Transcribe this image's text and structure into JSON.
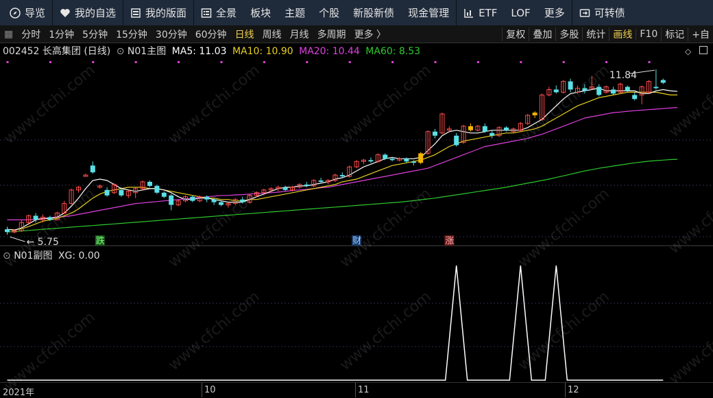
{
  "nav": {
    "items": [
      {
        "label": "导览",
        "icon": "compass-icon"
      },
      {
        "label": "我的自选",
        "icon": "heart-icon"
      },
      {
        "label": "我的版面",
        "icon": "layout-icon"
      },
      {
        "label": "全景",
        "icon": "panorama-icon"
      },
      {
        "label": "板块"
      },
      {
        "label": "主题"
      },
      {
        "label": "个股"
      },
      {
        "label": "新股新债"
      },
      {
        "label": "现金管理"
      },
      {
        "label": "ETF",
        "icon": "chart-icon"
      },
      {
        "label": "LOF"
      },
      {
        "label": "更多"
      },
      {
        "label": "可转债",
        "icon": "bond-icon"
      }
    ]
  },
  "toolbar": {
    "periods": [
      "分时",
      "1分钟",
      "5分钟",
      "15分钟",
      "30分钟",
      "60分钟",
      "日线",
      "周线",
      "月线",
      "多周期",
      "更多 〉"
    ],
    "active_period": "日线",
    "right": [
      "复权",
      "叠加",
      "多股",
      "统计",
      "画线",
      "F10",
      "标记",
      "+自"
    ]
  },
  "main_legend": {
    "stock": "002452 长高集团 (日线)",
    "indicator": "N01主图",
    "ma5": "MA5: 11.03",
    "ma10": "MA10: 10.90",
    "ma20": "MA20: 10.44",
    "ma60": "MA60: 8.53"
  },
  "sub_legend": {
    "indicator": "N01副图",
    "xg": "XG: 0.00"
  },
  "markers": {
    "die": "跌",
    "cai": "财",
    "zhang": "涨"
  },
  "annotations": {
    "high": "11.84",
    "low": "5.75"
  },
  "xaxis": [
    "2021年",
    "10",
    "11",
    "12"
  ],
  "watermark": "www.cfchi.com",
  "colors": {
    "up": "#ff4d4d",
    "down": "#5ae0e6",
    "gold": "#f5b400",
    "ma5": "#ffffff",
    "ma10": "#e8d020",
    "ma20": "#e040e0",
    "ma60": "#2ec82e",
    "xg": "#ffffff",
    "marker": "#e040e0"
  },
  "chart_data": {
    "type": "candlestick",
    "price_range": [
      5.5,
      12.3
    ],
    "candles": [
      {
        "o": 5.95,
        "h": 6.05,
        "l": 5.75,
        "c": 5.85
      },
      {
        "o": 5.85,
        "h": 5.95,
        "l": 5.8,
        "c": 5.9
      },
      {
        "o": 5.9,
        "h": 6.3,
        "l": 5.85,
        "c": 6.2
      },
      {
        "o": 6.2,
        "h": 6.5,
        "l": 6.15,
        "c": 6.45
      },
      {
        "o": 6.45,
        "h": 6.55,
        "l": 6.2,
        "c": 6.3
      },
      {
        "o": 6.3,
        "h": 6.5,
        "l": 6.2,
        "c": 6.4
      },
      {
        "o": 6.4,
        "h": 6.45,
        "l": 6.25,
        "c": 6.3
      },
      {
        "o": 6.3,
        "h": 6.6,
        "l": 6.28,
        "c": 6.55
      },
      {
        "o": 6.55,
        "h": 7.0,
        "l": 6.5,
        "c": 6.9
      },
      {
        "o": 6.9,
        "h": 7.45,
        "l": 6.85,
        "c": 7.4
      },
      {
        "o": 7.4,
        "h": 7.55,
        "l": 7.3,
        "c": 7.5
      },
      {
        "o": 7.9,
        "h": 8.0,
        "l": 7.9,
        "c": 7.95
      },
      {
        "o": 8.3,
        "h": 8.45,
        "l": 8.0,
        "c": 8.05
      },
      {
        "o": 7.5,
        "h": 7.6,
        "l": 7.45,
        "c": 7.55
      },
      {
        "o": 7.4,
        "h": 7.5,
        "l": 7.15,
        "c": 7.2
      },
      {
        "o": 7.3,
        "h": 7.65,
        "l": 7.25,
        "c": 7.6
      },
      {
        "o": 7.4,
        "h": 7.5,
        "l": 7.15,
        "c": 7.2
      },
      {
        "o": 7.2,
        "h": 7.4,
        "l": 7.1,
        "c": 7.35
      },
      {
        "o": 7.3,
        "h": 7.5,
        "l": 7.1,
        "c": 7.45
      },
      {
        "o": 7.45,
        "h": 7.75,
        "l": 7.4,
        "c": 7.7
      },
      {
        "o": 7.7,
        "h": 7.75,
        "l": 7.5,
        "c": 7.55
      },
      {
        "o": 7.55,
        "h": 7.6,
        "l": 7.25,
        "c": 7.3
      },
      {
        "o": 7.3,
        "h": 7.35,
        "l": 7.1,
        "c": 7.15
      },
      {
        "o": 7.2,
        "h": 7.25,
        "l": 6.65,
        "c": 6.85
      },
      {
        "o": 6.85,
        "h": 7.05,
        "l": 6.8,
        "c": 7.0
      },
      {
        "o": 7.0,
        "h": 7.2,
        "l": 6.95,
        "c": 7.15
      },
      {
        "o": 7.15,
        "h": 7.2,
        "l": 6.95,
        "c": 7.0
      },
      {
        "o": 7.0,
        "h": 7.2,
        "l": 6.95,
        "c": 7.15
      },
      {
        "o": 7.15,
        "h": 7.2,
        "l": 6.95,
        "c": 7.05
      },
      {
        "o": 7.05,
        "h": 7.1,
        "l": 6.85,
        "c": 6.95
      },
      {
        "o": 6.95,
        "h": 7.0,
        "l": 6.8,
        "c": 6.85
      },
      {
        "o": 6.85,
        "h": 6.95,
        "l": 6.75,
        "c": 6.9
      },
      {
        "o": 6.9,
        "h": 7.1,
        "l": 6.85,
        "c": 7.05
      },
      {
        "o": 7.05,
        "h": 7.15,
        "l": 6.9,
        "c": 6.95
      },
      {
        "o": 6.95,
        "h": 7.25,
        "l": 6.9,
        "c": 7.2
      },
      {
        "o": 7.2,
        "h": 7.35,
        "l": 7.15,
        "c": 7.3
      },
      {
        "o": 7.3,
        "h": 7.45,
        "l": 7.2,
        "c": 7.4
      },
      {
        "o": 7.4,
        "h": 7.5,
        "l": 7.3,
        "c": 7.45
      },
      {
        "o": 7.45,
        "h": 7.55,
        "l": 7.35,
        "c": 7.5
      },
      {
        "o": 7.5,
        "h": 7.55,
        "l": 7.35,
        "c": 7.4
      },
      {
        "o": 7.4,
        "h": 7.55,
        "l": 7.35,
        "c": 7.5
      },
      {
        "o": 7.5,
        "h": 7.65,
        "l": 7.45,
        "c": 7.6
      },
      {
        "o": 7.6,
        "h": 7.7,
        "l": 7.5,
        "c": 7.55
      },
      {
        "o": 7.55,
        "h": 7.8,
        "l": 7.5,
        "c": 7.75
      },
      {
        "o": 7.75,
        "h": 7.85,
        "l": 7.65,
        "c": 7.7
      },
      {
        "o": 7.7,
        "h": 7.8,
        "l": 7.6,
        "c": 7.75
      },
      {
        "o": 7.75,
        "h": 8.0,
        "l": 7.7,
        "c": 7.95
      },
      {
        "o": 7.95,
        "h": 8.05,
        "l": 7.85,
        "c": 7.9
      },
      {
        "o": 7.9,
        "h": 8.3,
        "l": 7.85,
        "c": 8.25
      },
      {
        "o": 8.25,
        "h": 8.5,
        "l": 8.2,
        "c": 8.45
      },
      {
        "o": 8.45,
        "h": 8.55,
        "l": 8.35,
        "c": 8.5
      },
      {
        "o": 8.5,
        "h": 8.6,
        "l": 8.4,
        "c": 8.45
      },
      {
        "o": 8.45,
        "h": 8.75,
        "l": 8.4,
        "c": 8.7
      },
      {
        "o": 8.7,
        "h": 8.75,
        "l": 8.5,
        "c": 8.55
      },
      {
        "o": 8.55,
        "h": 8.6,
        "l": 8.45,
        "c": 8.5
      },
      {
        "o": 8.5,
        "h": 8.6,
        "l": 8.45,
        "c": 8.55
      },
      {
        "o": 8.55,
        "h": 8.6,
        "l": 8.4,
        "c": 8.45
      },
      {
        "o": 8.45,
        "h": 8.5,
        "l": 8.3,
        "c": 8.4
      },
      {
        "o": 8.4,
        "h": 8.8,
        "l": 8.35,
        "c": 8.75
      },
      {
        "o": 8.75,
        "h": 9.6,
        "l": 8.7,
        "c": 9.55
      },
      {
        "o": 9.55,
        "h": 9.65,
        "l": 9.3,
        "c": 9.4
      },
      {
        "o": 9.5,
        "h": 10.25,
        "l": 9.45,
        "c": 10.2
      },
      {
        "o": 9.6,
        "h": 9.75,
        "l": 9.55,
        "c": 9.65
      },
      {
        "o": 9.4,
        "h": 9.5,
        "l": 9.0,
        "c": 9.05
      },
      {
        "o": 9.15,
        "h": 9.8,
        "l": 9.1,
        "c": 9.75
      },
      {
        "o": 9.75,
        "h": 9.85,
        "l": 9.55,
        "c": 9.6
      },
      {
        "o": 9.6,
        "h": 9.8,
        "l": 9.55,
        "c": 9.75
      },
      {
        "o": 9.75,
        "h": 9.85,
        "l": 9.5,
        "c": 9.55
      },
      {
        "o": 9.5,
        "h": 9.6,
        "l": 9.3,
        "c": 9.4
      },
      {
        "o": 9.4,
        "h": 9.75,
        "l": 9.35,
        "c": 9.7
      },
      {
        "o": 9.7,
        "h": 9.75,
        "l": 9.55,
        "c": 9.6
      },
      {
        "o": 9.55,
        "h": 9.7,
        "l": 9.5,
        "c": 9.65
      },
      {
        "o": 9.6,
        "h": 9.9,
        "l": 9.55,
        "c": 9.85
      },
      {
        "o": 9.85,
        "h": 10.2,
        "l": 9.8,
        "c": 10.15
      },
      {
        "o": 10.15,
        "h": 10.3,
        "l": 10.05,
        "c": 10.25
      },
      {
        "o": 10.0,
        "h": 10.95,
        "l": 9.95,
        "c": 10.9
      },
      {
        "o": 10.9,
        "h": 11.2,
        "l": 10.85,
        "c": 11.1
      },
      {
        "o": 11.1,
        "h": 11.25,
        "l": 10.95,
        "c": 11.0
      },
      {
        "o": 11.0,
        "h": 11.45,
        "l": 10.95,
        "c": 11.4
      },
      {
        "o": 11.4,
        "h": 11.5,
        "l": 11.0,
        "c": 11.1
      },
      {
        "o": 11.0,
        "h": 11.25,
        "l": 10.95,
        "c": 11.15
      },
      {
        "o": 11.15,
        "h": 11.3,
        "l": 10.95,
        "c": 11.05
      },
      {
        "o": 11.15,
        "h": 11.6,
        "l": 11.1,
        "c": 11.2
      },
      {
        "o": 11.2,
        "h": 11.3,
        "l": 10.85,
        "c": 10.9
      },
      {
        "o": 11.0,
        "h": 11.25,
        "l": 10.95,
        "c": 11.2
      },
      {
        "o": 11.1,
        "h": 11.2,
        "l": 10.9,
        "c": 10.95
      },
      {
        "o": 11.0,
        "h": 11.35,
        "l": 10.95,
        "c": 11.3
      },
      {
        "o": 11.2,
        "h": 11.25,
        "l": 11.0,
        "c": 11.05
      },
      {
        "o": 10.9,
        "h": 11.0,
        "l": 10.7,
        "c": 10.75
      },
      {
        "o": 10.9,
        "h": 11.25,
        "l": 10.55,
        "c": 11.2
      },
      {
        "o": 11.0,
        "h": 11.45,
        "l": 10.95,
        "c": 11.4
      },
      {
        "o": 11.2,
        "h": 11.84,
        "l": 11.1,
        "c": 11.15
      },
      {
        "o": 11.45,
        "h": 11.5,
        "l": 11.3,
        "c": 11.35
      }
    ],
    "gold_candles": [
      58,
      65,
      74
    ],
    "ma5": [
      5.95,
      5.92,
      6.0,
      6.15,
      6.3,
      6.35,
      6.35,
      6.4,
      6.55,
      6.8,
      7.1,
      7.45,
      7.75,
      7.8,
      7.75,
      7.6,
      7.45,
      7.4,
      7.35,
      7.4,
      7.45,
      7.45,
      7.4,
      7.3,
      7.15,
      7.05,
      7.05,
      7.1,
      7.1,
      7.05,
      7.0,
      6.95,
      6.95,
      6.95,
      7.05,
      7.15,
      7.25,
      7.35,
      7.45,
      7.5,
      7.5,
      7.55,
      7.55,
      7.6,
      7.65,
      7.7,
      7.8,
      7.85,
      7.95,
      8.1,
      8.25,
      8.35,
      8.45,
      8.55,
      8.6,
      8.55,
      8.55,
      8.55,
      8.6,
      8.85,
      9.1,
      9.4,
      9.55,
      9.6,
      9.55,
      9.5,
      9.5,
      9.55,
      9.6,
      9.6,
      9.6,
      9.6,
      9.6,
      9.7,
      9.85,
      10.0,
      10.25,
      10.5,
      10.75,
      10.95,
      11.0,
      11.05,
      11.1,
      11.15,
      11.05,
      11.05,
      11.05,
      11.05,
      11.05,
      10.95,
      10.95,
      11.05,
      11.1,
      11.05,
      11.03
    ],
    "ma10": [
      5.95,
      5.93,
      5.97,
      6.05,
      6.15,
      6.25,
      6.3,
      6.35,
      6.45,
      6.55,
      6.7,
      6.9,
      7.1,
      7.25,
      7.35,
      7.4,
      7.45,
      7.5,
      7.5,
      7.5,
      7.45,
      7.45,
      7.4,
      7.35,
      7.3,
      7.25,
      7.2,
      7.15,
      7.1,
      7.1,
      7.05,
      7.05,
      7.0,
      7.0,
      7.05,
      7.05,
      7.1,
      7.15,
      7.2,
      7.25,
      7.3,
      7.35,
      7.4,
      7.45,
      7.5,
      7.55,
      7.6,
      7.7,
      7.75,
      7.8,
      7.9,
      8.0,
      8.1,
      8.2,
      8.3,
      8.35,
      8.4,
      8.45,
      8.5,
      8.6,
      8.7,
      8.85,
      9.0,
      9.1,
      9.2,
      9.25,
      9.3,
      9.35,
      9.4,
      9.45,
      9.5,
      9.5,
      9.55,
      9.6,
      9.65,
      9.75,
      9.9,
      10.05,
      10.2,
      10.35,
      10.5,
      10.6,
      10.7,
      10.8,
      10.85,
      10.9,
      10.95,
      11.0,
      11.0,
      11.0,
      11.0,
      11.0,
      10.95,
      10.9,
      10.9
    ],
    "ma20": [
      6.3,
      6.3,
      6.3,
      6.3,
      6.32,
      6.35,
      6.38,
      6.4,
      6.42,
      6.45,
      6.5,
      6.55,
      6.6,
      6.65,
      6.7,
      6.75,
      6.8,
      6.85,
      6.9,
      6.92,
      6.95,
      6.97,
      7.0,
      7.02,
      7.05,
      7.07,
      7.1,
      7.12,
      7.15,
      7.17,
      7.2,
      7.2,
      7.22,
      7.23,
      7.25,
      7.27,
      7.28,
      7.3,
      7.32,
      7.35,
      7.38,
      7.4,
      7.42,
      7.45,
      7.48,
      7.5,
      7.55,
      7.6,
      7.65,
      7.7,
      7.75,
      7.8,
      7.85,
      7.9,
      7.95,
      8.0,
      8.05,
      8.1,
      8.15,
      8.2,
      8.3,
      8.4,
      8.5,
      8.6,
      8.7,
      8.8,
      8.9,
      9.0,
      9.05,
      9.1,
      9.15,
      9.2,
      9.25,
      9.3,
      9.38,
      9.45,
      9.55,
      9.65,
      9.75,
      9.85,
      9.95,
      10.05,
      10.1,
      10.15,
      10.2,
      10.25,
      10.27,
      10.3,
      10.32,
      10.34,
      10.36,
      10.38,
      10.4,
      10.42,
      10.44
    ],
    "ma60": [
      5.85,
      5.87,
      5.89,
      5.91,
      5.93,
      5.95,
      5.97,
      5.99,
      6.01,
      6.03,
      6.05,
      6.07,
      6.09,
      6.11,
      6.13,
      6.15,
      6.17,
      6.19,
      6.21,
      6.23,
      6.25,
      6.27,
      6.29,
      6.31,
      6.33,
      6.35,
      6.37,
      6.39,
      6.41,
      6.43,
      6.45,
      6.47,
      6.49,
      6.51,
      6.53,
      6.55,
      6.57,
      6.59,
      6.61,
      6.63,
      6.65,
      6.67,
      6.69,
      6.71,
      6.73,
      6.75,
      6.77,
      6.79,
      6.81,
      6.83,
      6.85,
      6.87,
      6.89,
      6.91,
      6.93,
      6.95,
      6.98,
      7.01,
      7.04,
      7.07,
      7.1,
      7.14,
      7.18,
      7.22,
      7.26,
      7.3,
      7.34,
      7.38,
      7.42,
      7.46,
      7.5,
      7.55,
      7.6,
      7.65,
      7.7,
      7.75,
      7.8,
      7.86,
      7.92,
      7.98,
      8.04,
      8.1,
      8.15,
      8.2,
      8.24,
      8.28,
      8.32,
      8.36,
      8.4,
      8.43,
      8.46,
      8.48,
      8.5,
      8.52,
      8.53
    ],
    "xg_series": {
      "range": [
        0,
        1
      ],
      "peaks_at_candle": [
        63,
        72,
        77
      ]
    }
  }
}
